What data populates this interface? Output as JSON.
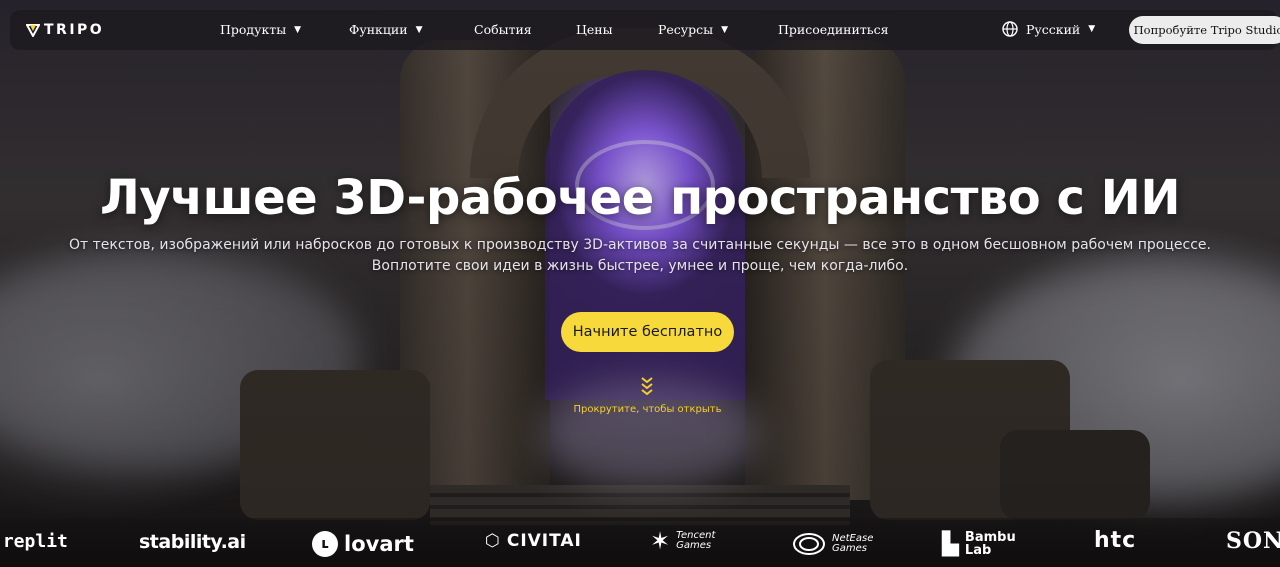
{
  "nav": {
    "logo_text": "TRIPO",
    "items": [
      {
        "label": "Продукты",
        "has_dropdown": true
      },
      {
        "label": "Функции",
        "has_dropdown": true
      },
      {
        "label": "События",
        "has_dropdown": false
      },
      {
        "label": "Цены",
        "has_dropdown": false
      },
      {
        "label": "Ресурсы",
        "has_dropdown": true
      },
      {
        "label": "Присоединиться",
        "has_dropdown": false
      }
    ],
    "language": "Русский",
    "cta_label": "Попробуйте Tripo Studio"
  },
  "hero": {
    "title": "Лучшее 3D-рабочее пространство с ИИ",
    "subtitle_line1": "От текстов, изображений или набросков до готовых к производству 3D-активов за считанные секунды — все это в одном бесшовном рабочем процессе.",
    "subtitle_line2": "Воплотите свои идеи в жизнь быстрее, умнее и проще, чем когда-либо.",
    "cta_label": "Начните бесплатно",
    "scroll_hint": "Прокрутите, чтобы открыть"
  },
  "partners": {
    "replit": "replit",
    "stability": "stability.ai",
    "lovart": "lovart",
    "civitai": "CIVITAI",
    "tencent_line1": "Tencent",
    "tencent_line2": "Games",
    "netease_line1": "NetEase",
    "netease_line2": "Games",
    "bambu_line1": "Bambu",
    "bambu_line2": "Lab",
    "htc": "htc",
    "sony": "SONY"
  },
  "colors": {
    "accent_yellow": "#f7d93b",
    "scroll_hint": "#f5cf2f",
    "portal_purple": "#8b5cf0"
  }
}
